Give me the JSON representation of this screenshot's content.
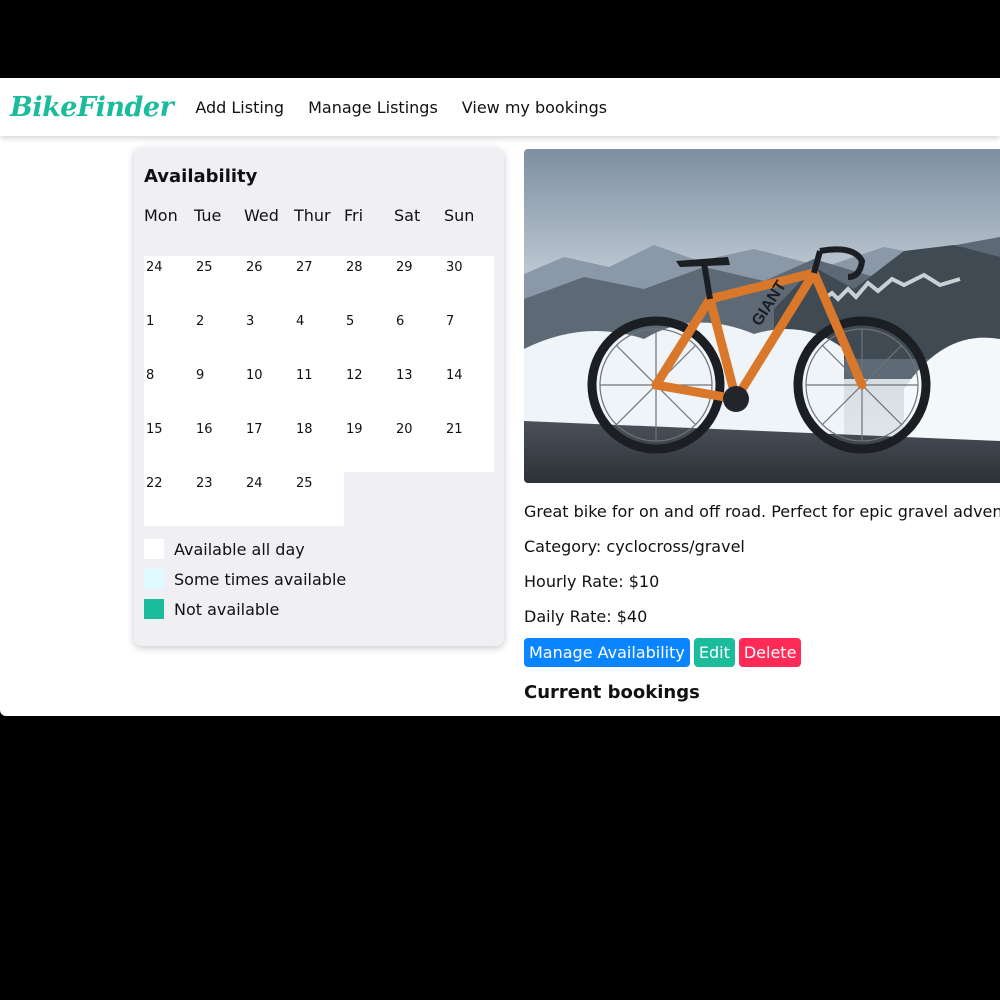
{
  "app": {
    "brand": "BikeFinder",
    "brand_color": "#1abc9c"
  },
  "nav": {
    "links": [
      {
        "label": "Add Listing"
      },
      {
        "label": "Manage Listings"
      },
      {
        "label": "View my bookings"
      }
    ]
  },
  "calendar": {
    "title": "Availability",
    "weekdays": [
      "Mon",
      "Tue",
      "Wed",
      "Thur",
      "Fri",
      "Sat",
      "Sun"
    ],
    "days": [
      "24",
      "25",
      "26",
      "27",
      "28",
      "29",
      "30",
      "1",
      "2",
      "3",
      "4",
      "5",
      "6",
      "7",
      "8",
      "9",
      "10",
      "11",
      "12",
      "13",
      "14",
      "15",
      "16",
      "17",
      "18",
      "19",
      "20",
      "21",
      "22",
      "23",
      "24",
      "25"
    ],
    "legend": [
      {
        "label": "Available all day",
        "color": "#ffffff"
      },
      {
        "label": "Some times available",
        "color": "#dffbff"
      },
      {
        "label": "Not available",
        "color": "#1abc9c"
      }
    ]
  },
  "listing": {
    "image_alt": "Orange gravel bike on a snowy mountain road",
    "description": "Great bike for on and off road. Perfect for epic gravel adventures",
    "category": "Category: cyclocross/gravel",
    "hourly_rate": "Hourly Rate: $10",
    "daily_rate": "Daily Rate: $40",
    "actions": {
      "manage_availability": "Manage Availability",
      "edit": "Edit",
      "delete": "Delete"
    },
    "action_colors": {
      "manage_availability": "#0a84ff",
      "edit": "#1abc9c",
      "delete": "#ff2a55"
    },
    "bookings_heading": "Current bookings"
  }
}
